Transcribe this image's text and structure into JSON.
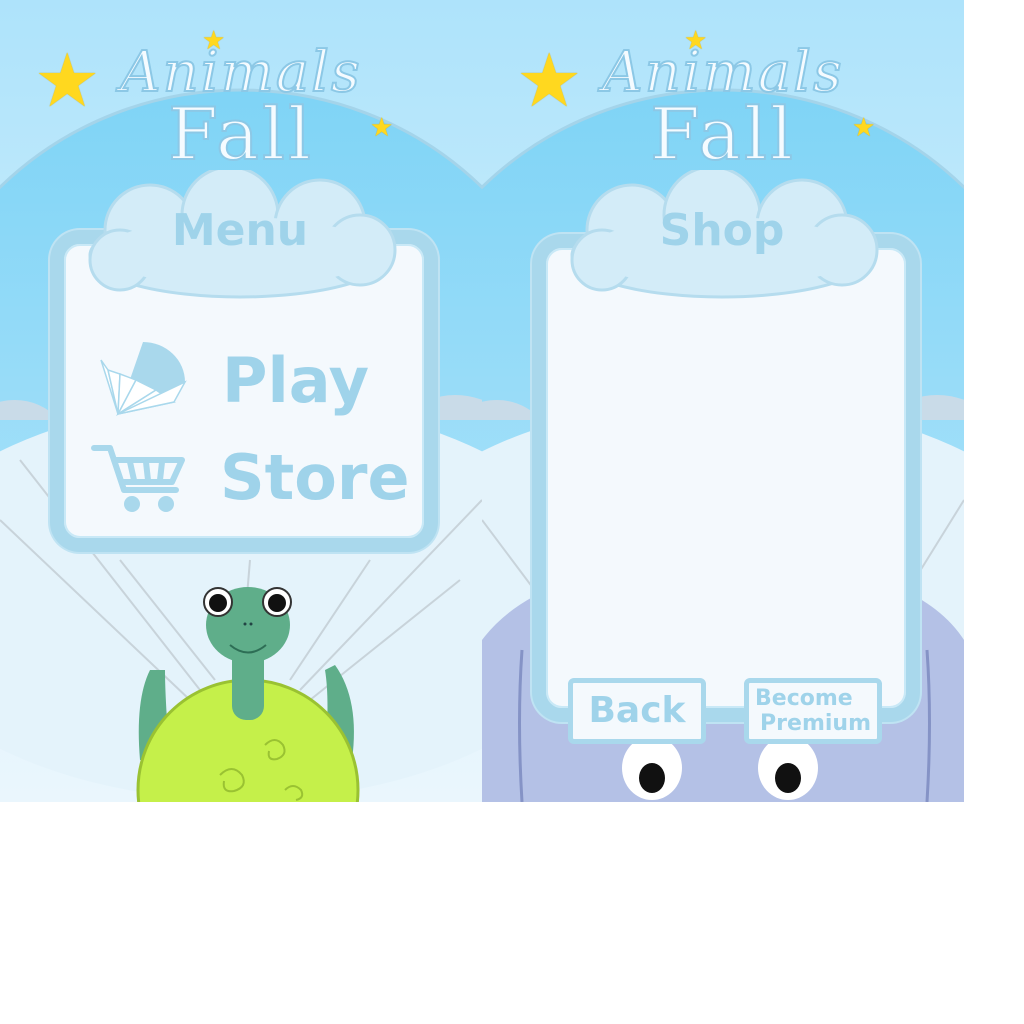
{
  "game": {
    "title_line1": "Animals",
    "title_line2": "Fall"
  },
  "menu_screen": {
    "panel_title": "Menu",
    "items": [
      {
        "label": "Play",
        "icon": "parachute-icon"
      },
      {
        "label": "Store",
        "icon": "shopping-cart-icon"
      }
    ],
    "character": "turtle"
  },
  "shop_screen": {
    "panel_title": "Shop",
    "back_label": "Back",
    "premium_label_line1": "Become",
    "premium_label_line2": "Premium",
    "character": "hippo"
  },
  "colors": {
    "accent": "#9fd3ea",
    "panel_border": "#a9d8ec",
    "star": "#ffd81f",
    "turtle_skin": "#5fae8a",
    "turtle_shell": "#c5f04a",
    "hippo": "#b4c1e6"
  }
}
